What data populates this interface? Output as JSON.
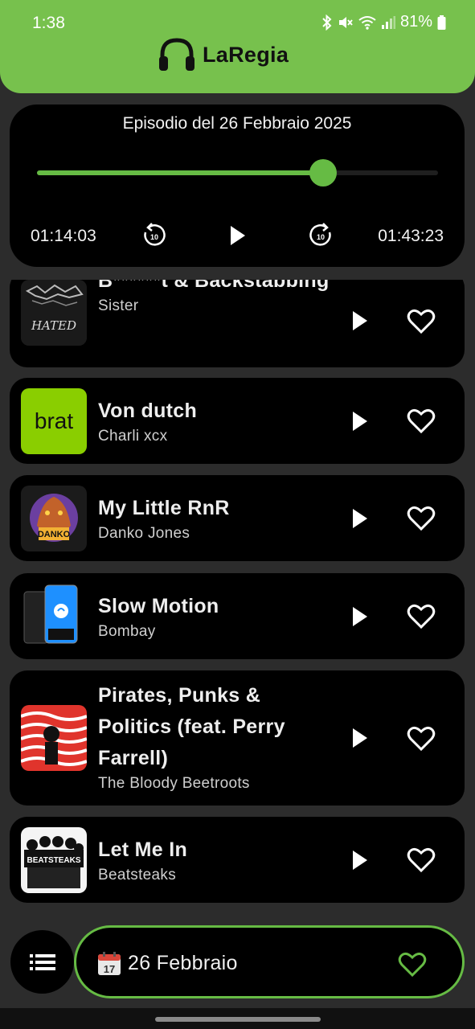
{
  "status_bar": {
    "time": "1:38",
    "battery": "81%",
    "icons": [
      "bluetooth-icon",
      "mute-icon",
      "wifi-icon",
      "signal-icon",
      "battery-icon"
    ]
  },
  "app": {
    "name": "LaRegia",
    "logo_icon": "headphones-icon",
    "accent_color": "#77c14d",
    "progress_color": "#66bb44"
  },
  "player": {
    "episode_title": "Episodio del 26 Febbraio 2025",
    "elapsed": "01:14:03",
    "total": "01:43:23",
    "progress": 0.713,
    "rewind_seconds": "10",
    "forward_seconds": "10"
  },
  "tracks": [
    {
      "title": "B******t & Backstabbing",
      "artist": "Sister",
      "cover": "sister-hated-cover"
    },
    {
      "title": "Von dutch",
      "artist": "Charli xcx",
      "cover": "brat-cover",
      "cover_text": "brat",
      "cover_color": "#8ace00"
    },
    {
      "title": "My Little RnR",
      "artist": "Danko Jones",
      "cover": "danko-jones-cover"
    },
    {
      "title": "Slow Motion",
      "artist": "Bombay",
      "cover": "shazam-phones-cover"
    },
    {
      "title": "Pirates, Punks & Politics (feat. Perry Farrell)",
      "artist": "The Bloody Beetroots",
      "cover": "bloody-beetroots-cover"
    },
    {
      "title": "Let Me In",
      "artist": "Beatsteaks",
      "cover": "beatsteaks-cover"
    }
  ],
  "bottom_bar": {
    "date_label": "26 Febbraio",
    "calendar_icon": "calendar-icon",
    "calendar_day": "17"
  }
}
